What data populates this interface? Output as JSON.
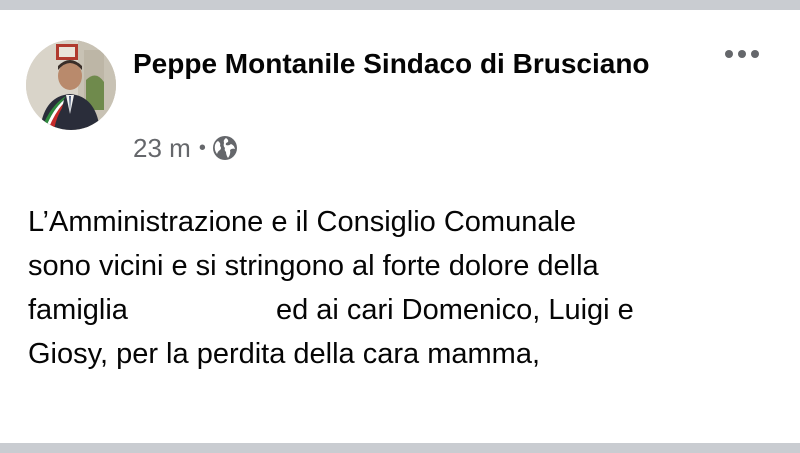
{
  "post": {
    "author": "Peppe Montanile Sindaco di Brusciano",
    "timestamp": "23 m",
    "separator": "•",
    "audience_icon": "globe-icon",
    "more_icon": "more-dots-icon",
    "text_lines": [
      "L’Amministrazione e il Consiglio Comunale",
      "sono vicini e si stringono al forte dolore della",
      "famiglia",
      "ed ai cari Domenico, Luigi e",
      "Giosy, per la perdita della cara mamma,"
    ]
  },
  "colors": {
    "text_primary": "#050505",
    "text_secondary": "#65676b",
    "background": "#ffffff",
    "frame": "#c9ccd1"
  }
}
